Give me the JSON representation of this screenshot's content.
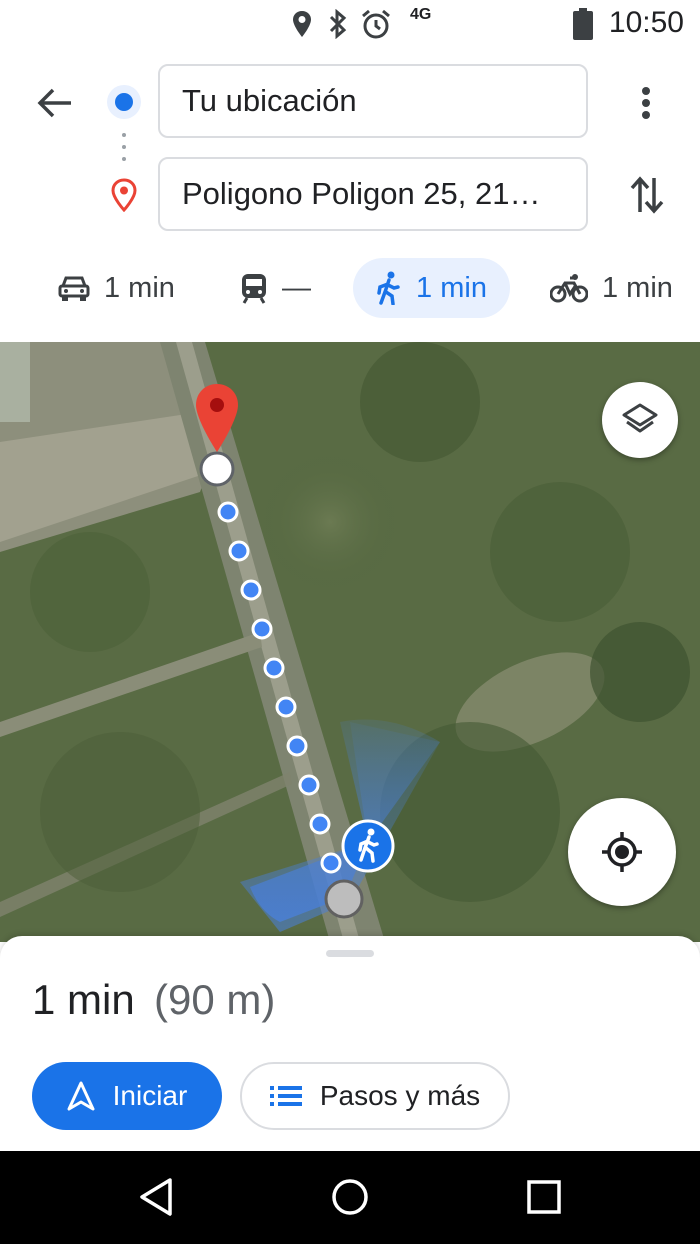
{
  "status_bar": {
    "network": "4G",
    "time": "10:50",
    "icons": [
      "location-icon",
      "bluetooth-icon",
      "alarm-icon",
      "battery-icon"
    ]
  },
  "directions": {
    "origin": "Tu ubicación",
    "destination": "Poligono Poligon 25, 21…"
  },
  "modes": [
    {
      "name": "car",
      "label": "1 min"
    },
    {
      "name": "transit",
      "label": "—"
    },
    {
      "name": "walk",
      "label": "1 min",
      "selected": true
    },
    {
      "name": "bike",
      "label": "1 min"
    }
  ],
  "route": {
    "duration": "1 min",
    "distance": "(90 m)"
  },
  "actions": {
    "start_label": "Iniciar",
    "steps_label": "Pasos y más"
  },
  "colors": {
    "accent": "#1a73e8",
    "pin": "#ea4335",
    "route_dot": "#4285f4"
  }
}
